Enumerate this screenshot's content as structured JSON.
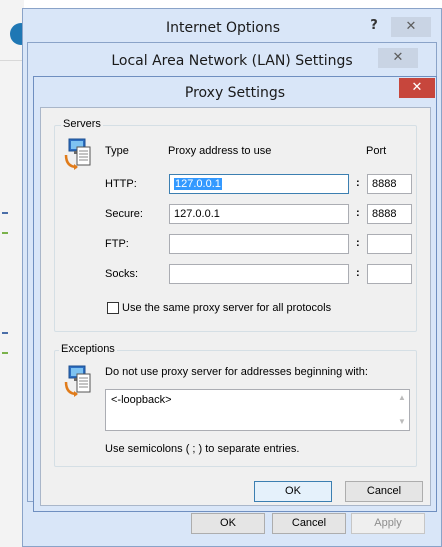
{
  "internet_options": {
    "title": "Internet Options",
    "help_glyph": "?",
    "close_glyph": "✕",
    "buttons": {
      "ok": "OK",
      "cancel": "Cancel",
      "apply": "Apply"
    }
  },
  "lan_settings": {
    "title": "Local Area Network (LAN) Settings",
    "close_glyph": "✕"
  },
  "proxy_settings": {
    "title": "Proxy Settings",
    "close_glyph": "✕",
    "servers": {
      "group_label": "Servers",
      "col_type": "Type",
      "col_address": "Proxy address to use",
      "col_port": "Port",
      "rows": [
        {
          "type": "HTTP:",
          "address": "127.0.0.1",
          "port": "8888"
        },
        {
          "type": "Secure:",
          "address": "127.0.0.1",
          "port": "8888"
        },
        {
          "type": "FTP:",
          "address": "",
          "port": ""
        },
        {
          "type": "Socks:",
          "address": "",
          "port": ""
        }
      ],
      "colon": ":",
      "same_proxy_label": "Use the same proxy server for all protocols",
      "same_proxy_checked": false
    },
    "exceptions": {
      "group_label": "Exceptions",
      "description": "Do not use proxy server for addresses beginning with:",
      "value": "<-loopback>",
      "hint": "Use semicolons ( ; ) to separate entries."
    },
    "buttons": {
      "ok": "OK",
      "cancel": "Cancel"
    }
  },
  "colors": {
    "title_bar": "#d9e6f8",
    "close_active": "#c7463c",
    "selection": "#3399ff",
    "default_button_border": "#3c7fb1"
  },
  "icons": {
    "servers": "network-computer-icon",
    "exceptions": "network-computer-icon"
  }
}
